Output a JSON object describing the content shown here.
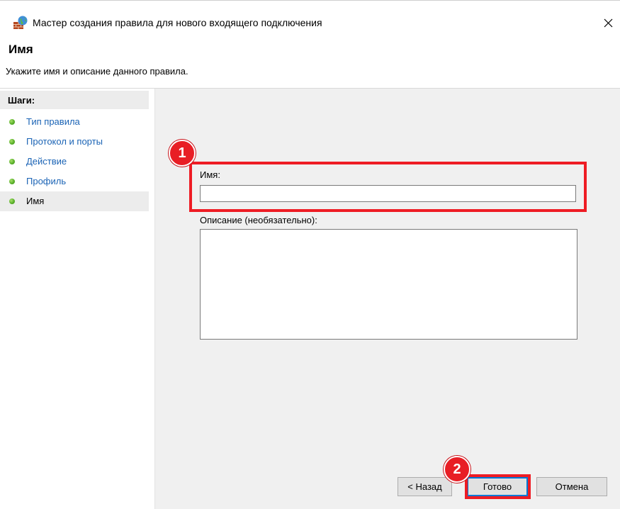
{
  "window": {
    "title": "Мастер создания правила для нового входящего подключения",
    "icon": "firewall-icon",
    "close_glyph": "✕"
  },
  "header": {
    "title": "Имя",
    "subtitle": "Укажите имя и описание данного правила."
  },
  "steps": {
    "title": "Шаги:",
    "items": [
      {
        "label": "Тип правила",
        "active": false
      },
      {
        "label": "Протокол и порты",
        "active": false
      },
      {
        "label": "Действие",
        "active": false
      },
      {
        "label": "Профиль",
        "active": false
      },
      {
        "label": "Имя",
        "active": true
      }
    ]
  },
  "form": {
    "name_label": "Имя:",
    "name_value": "",
    "description_label": "Описание (необязательно):",
    "description_value": ""
  },
  "buttons": {
    "back": "< Назад",
    "finish": "Готово",
    "cancel": "Отмена"
  },
  "annotations": {
    "marker_1": "1",
    "marker_2": "2",
    "color": "#ee1c24"
  },
  "colors": {
    "link": "#1a63b5",
    "content_bg": "#f0f0f0",
    "step_dot": "#5ab02a"
  }
}
